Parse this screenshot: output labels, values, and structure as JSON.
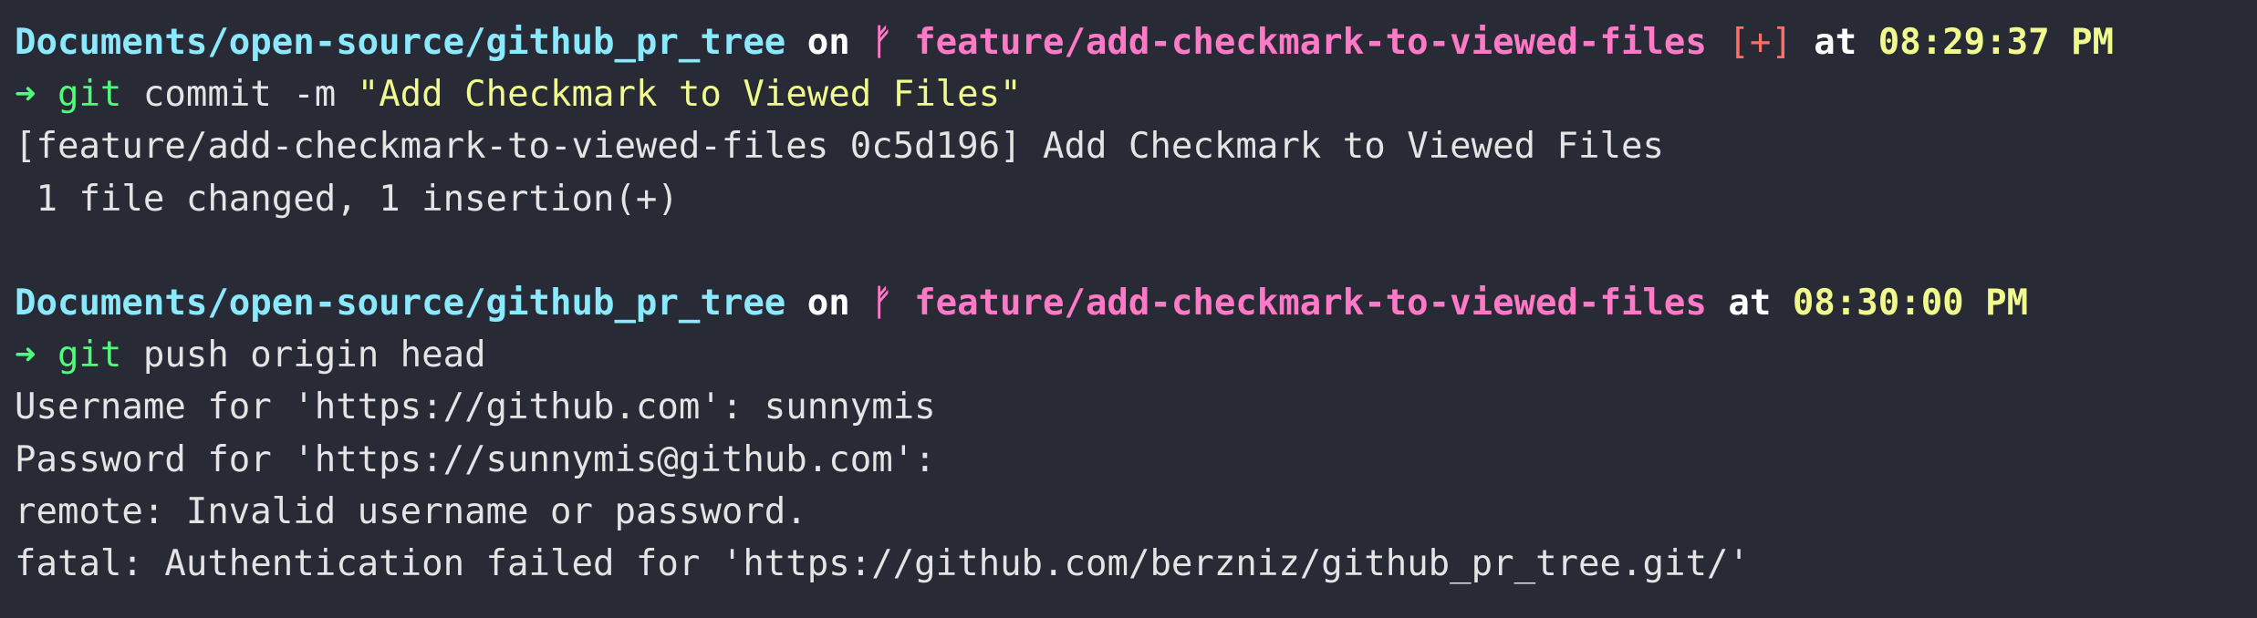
{
  "prompts": [
    {
      "path": "Documents/open-source/github_pr_tree",
      "on_label": "on",
      "branch_icon": "ᚠ",
      "branch": "feature/add-checkmark-to-viewed-files",
      "dirty": "[+]",
      "at_label": "at",
      "time": "08:29:37 PM",
      "arrow": "➜",
      "command": "git",
      "args": "commit -m",
      "string_arg": "\"Add Checkmark to Viewed Files\"",
      "output": [
        "[feature/add-checkmark-to-viewed-files 0c5d196] Add Checkmark to Viewed Files",
        " 1 file changed, 1 insertion(+)"
      ]
    },
    {
      "path": "Documents/open-source/github_pr_tree",
      "on_label": "on",
      "branch_icon": "ᚠ",
      "branch": "feature/add-checkmark-to-viewed-files",
      "at_label": "at",
      "time": "08:30:00 PM",
      "arrow": "➜",
      "command": "git",
      "args": "push origin head",
      "output": [
        "Username for 'https://github.com': sunnymis",
        "Password for 'https://sunnymis@github.com':",
        "remote: Invalid username or password.",
        "fatal: Authentication failed for 'https://github.com/berzniz/github_pr_tree.git/'"
      ]
    }
  ],
  "colors": {
    "background": "#282a36",
    "path": "#8be9fd",
    "branch": "#ff79c6",
    "time": "#f1fa8c",
    "arrow": "#50fa7b",
    "dirty": "#ff6e67",
    "text": "#e4e4e4"
  }
}
